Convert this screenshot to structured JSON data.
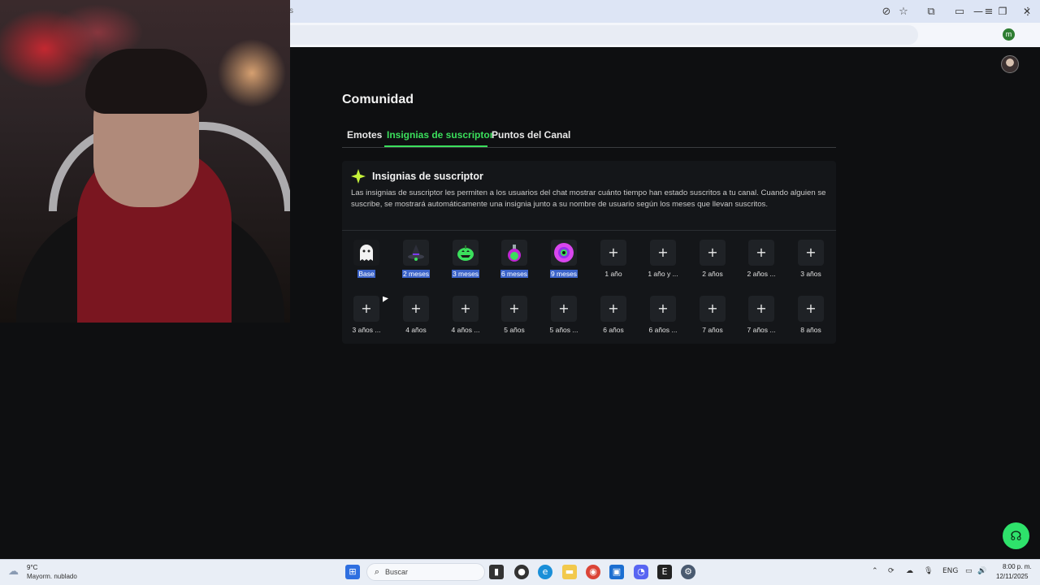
{
  "browser": {
    "url_fragment": "s",
    "profile_initial": "m",
    "window_controls": {
      "minimize": "—",
      "maximize": "❐",
      "close": "✕"
    }
  },
  "page": {
    "title": "Comunidad",
    "tabs": [
      {
        "label": "Emotes",
        "active": false
      },
      {
        "label": "Insignias de suscriptor",
        "active": true
      },
      {
        "label": "Puntos del Canal",
        "active": false
      }
    ],
    "accent_color": "#3bdf5c"
  },
  "card": {
    "title": "Insignias de suscriptor",
    "description": "Las insignias de suscriptor les permiten a los usuarios del chat mostrar cuánto tiempo han estado suscritos a tu canal. Cuando alguien se suscribe, se mostrará automáticamente una insignia junto a su nombre de usuario según los meses que llevan suscritos.",
    "badges_row1": [
      {
        "label": "Base",
        "icon": "ghost-icon",
        "selected": true
      },
      {
        "label": "2 meses",
        "icon": "witch-hat-icon",
        "selected": true
      },
      {
        "label": "3 meses",
        "icon": "pumpkin-icon",
        "selected": true
      },
      {
        "label": "6 meses",
        "icon": "potion-icon",
        "selected": true
      },
      {
        "label": "9 meses",
        "icon": "eye-icon",
        "selected": true
      },
      {
        "label": "1 año",
        "icon": "plus-icon",
        "selected": false
      },
      {
        "label": "1 año y ...",
        "icon": "plus-icon",
        "selected": false
      },
      {
        "label": "2 años",
        "icon": "plus-icon",
        "selected": false
      },
      {
        "label": "2 años ...",
        "icon": "plus-icon",
        "selected": false
      },
      {
        "label": "3 años",
        "icon": "plus-icon",
        "selected": false
      }
    ],
    "badges_row2": [
      {
        "label": "3 años ...",
        "icon": "plus-icon"
      },
      {
        "label": "4 años",
        "icon": "plus-icon"
      },
      {
        "label": "4 años ...",
        "icon": "plus-icon"
      },
      {
        "label": "5 años",
        "icon": "plus-icon"
      },
      {
        "label": "5 años ...",
        "icon": "plus-icon"
      },
      {
        "label": "6 años",
        "icon": "plus-icon"
      },
      {
        "label": "6 años ...",
        "icon": "plus-icon"
      },
      {
        "label": "7 años",
        "icon": "plus-icon"
      },
      {
        "label": "7 años ...",
        "icon": "plus-icon"
      },
      {
        "label": "8 años",
        "icon": "plus-icon"
      }
    ],
    "plus_symbol": "+"
  },
  "taskbar": {
    "weather_temp": "9°C",
    "weather_desc": "Mayorm. nublado",
    "search_placeholder": "Buscar",
    "language": "ENG",
    "time": "8:00 p. m.",
    "date": "12/11/2025"
  }
}
